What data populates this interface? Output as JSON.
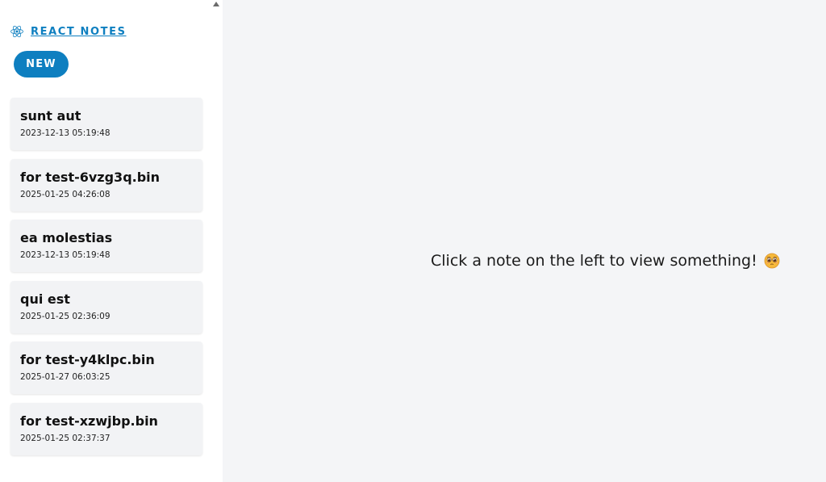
{
  "sidebar": {
    "brand": {
      "label": "REACT NOTES",
      "icon": "react-icon"
    },
    "new_button_label": "NEW",
    "notes": [
      {
        "title": "sunt aut",
        "date": "2023-12-13 05:19:48"
      },
      {
        "title": "for test-6vzg3q.bin",
        "date": "2025-01-25 04:26:08"
      },
      {
        "title": "ea molestias",
        "date": "2023-12-13 05:19:48"
      },
      {
        "title": "qui est",
        "date": "2025-01-25 02:36:09"
      },
      {
        "title": "for test-y4klpc.bin",
        "date": "2025-01-27 06:03:25"
      },
      {
        "title": "for test-xzwjbp.bin",
        "date": "2025-01-25 02:37:37"
      }
    ]
  },
  "main": {
    "empty_message": "Click a note on the left to view something!",
    "empty_icon": "pleading-face-icon"
  },
  "colors": {
    "accent": "#0e7fc0",
    "sidebar_bg": "#ffffff",
    "card_bg": "#f2f3f5",
    "main_bg": "#f4f5f7"
  }
}
